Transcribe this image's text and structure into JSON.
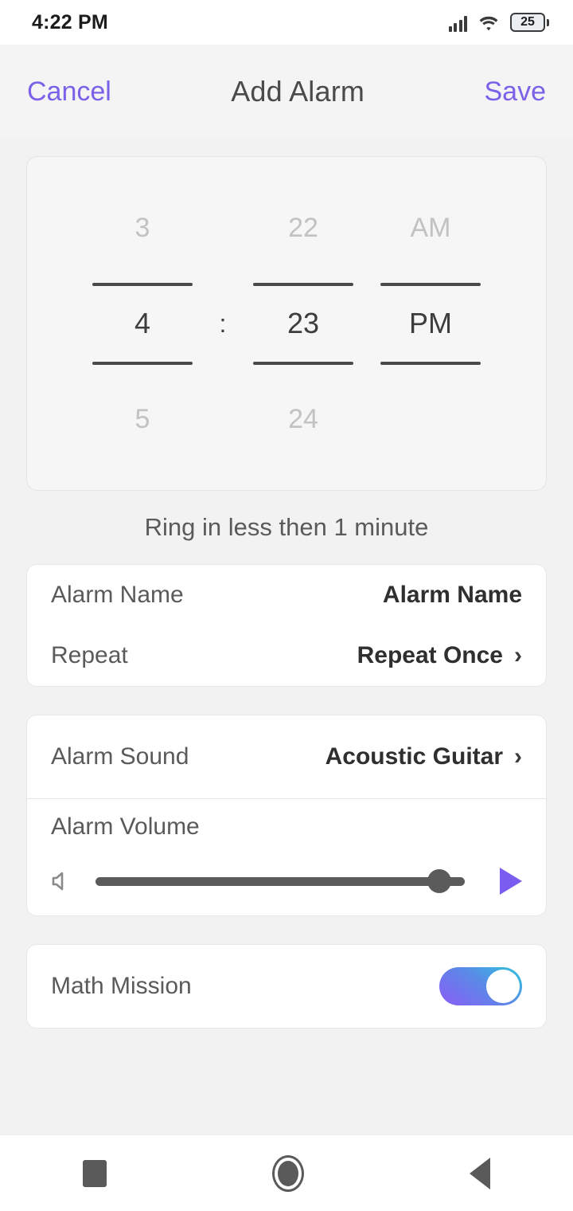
{
  "status_bar": {
    "time": "4:22 PM",
    "battery_level": "25",
    "icons": [
      "signal-icon",
      "wifi-icon",
      "battery-icon"
    ]
  },
  "header": {
    "cancel_label": "Cancel",
    "title": "Add Alarm",
    "save_label": "Save",
    "accent_color": "#7b61e8"
  },
  "time_picker": {
    "hours": {
      "previous": "3",
      "selected": "4",
      "next": "5"
    },
    "separator": ":",
    "minutes": {
      "previous": "22",
      "selected": "23",
      "next": "24"
    },
    "period": {
      "previous": "AM",
      "selected": "PM",
      "next": ""
    }
  },
  "ring_note": "Ring in less then 1 minute",
  "settings_card": {
    "rows": [
      {
        "label": "Alarm Name",
        "value": "Alarm Name",
        "chevron": ""
      },
      {
        "label": "Repeat",
        "value": "Repeat Once",
        "chevron": "›"
      }
    ]
  },
  "sound_card": {
    "sound_row": {
      "label": "Alarm Sound",
      "value": "Acoustic Guitar",
      "chevron": "›"
    },
    "volume": {
      "label": "Alarm Volume",
      "level_percent": "93",
      "speaker_icon": "speaker-icon",
      "play_icon": "play-icon",
      "play_color": "#7b5cf0"
    }
  },
  "mission_card": {
    "label": "Math Mission",
    "toggle_state": "on",
    "toggle_gradient_from": "#2fc4dd",
    "toggle_gradient_to": "#8b5cf6"
  },
  "nav_bar": {
    "recents": "square-icon",
    "home": "home-circle-icon",
    "back": "back-triangle-icon"
  }
}
